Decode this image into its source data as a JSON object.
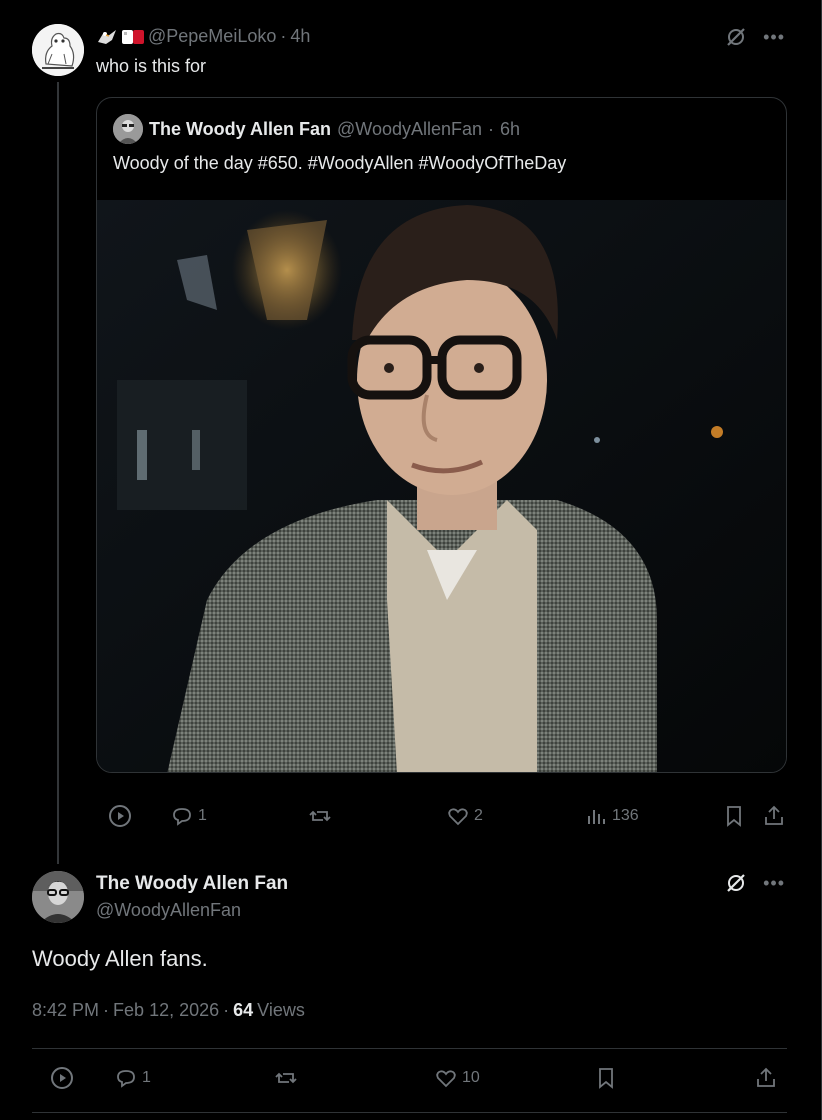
{
  "parent_tweet": {
    "handle": "@PepeMeiLoko",
    "separator": "·",
    "time": "4h",
    "text": "who is this for",
    "quoted": {
      "name": "The Woody Allen Fan",
      "handle": "@WoodyAllenFan",
      "separator": "·",
      "time": "6h",
      "text": "Woody of the day #650. #WoodyAllen #WoodyOfTheDay"
    },
    "actions": {
      "replies": "1",
      "reposts": "",
      "likes": "2",
      "views": "136"
    }
  },
  "main_tweet": {
    "name": "The Woody Allen Fan",
    "handle": "@WoodyAllenFan",
    "text": "Woody Allen fans.",
    "time": "8:42 PM",
    "date": "Feb 12, 2026",
    "sep": "·",
    "views_count": "64",
    "views_label": "Views",
    "actions": {
      "replies": "1",
      "reposts": "",
      "likes": "10"
    }
  },
  "icons": {
    "more": "more-icon",
    "grok": "grok-icon",
    "play": "play-icon",
    "reply": "reply-icon",
    "repost": "repost-icon",
    "like": "heart-icon",
    "views": "views-icon",
    "bookmark": "bookmark-icon",
    "share": "share-icon"
  },
  "colors": {
    "background": "#000000",
    "text": "#e7e9ea",
    "secondary": "#71767b",
    "border": "#2f3336"
  }
}
